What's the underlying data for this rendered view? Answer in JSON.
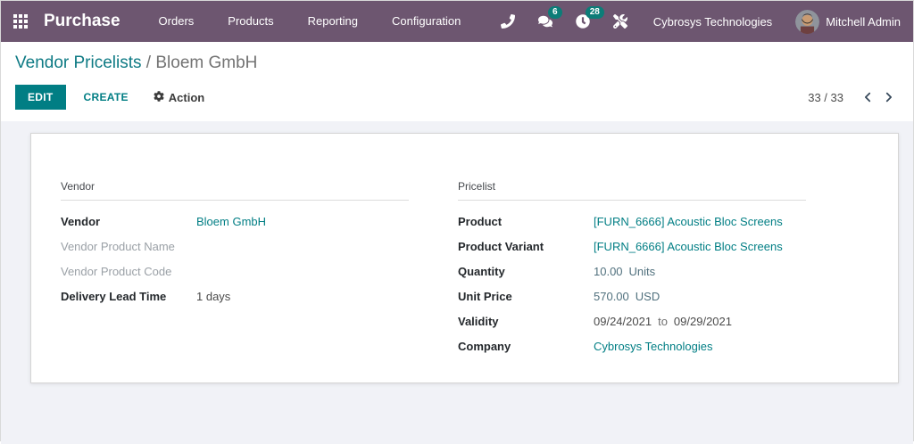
{
  "colors": {
    "navbar_bg": "#6d5670",
    "accent_teal": "#017e84",
    "badge_teal": "#0c7d78",
    "page_bg": "#f1f2f7",
    "link_teal": "#017e84"
  },
  "navbar": {
    "brand": "Purchase",
    "menus": {
      "orders": "Orders",
      "products": "Products",
      "reporting": "Reporting",
      "configuration": "Configuration"
    },
    "badges": {
      "messages": "6",
      "activities": "28"
    },
    "company": "Cybrosys Technologies",
    "user": "Mitchell Admin"
  },
  "breadcrumb": {
    "parent": "Vendor Pricelists",
    "separator": " / ",
    "current": "Bloem GmbH"
  },
  "control_panel": {
    "edit": "EDIT",
    "create": "CREATE",
    "action": "Action",
    "pager_count": "33 / 33"
  },
  "form": {
    "vendor": {
      "title": "Vendor",
      "vendor_label": "Vendor",
      "vendor_value": "Bloem GmbH",
      "product_name_label": "Vendor Product Name",
      "product_code_label": "Vendor Product Code",
      "lead_time_label": "Delivery Lead Time",
      "lead_time_value": "1 days"
    },
    "pricelist": {
      "title": "Pricelist",
      "product_label": "Product",
      "product_value": "[FURN_6666] Acoustic Bloc Screens",
      "variant_label": "Product Variant",
      "variant_value": "[FURN_6666] Acoustic Bloc Screens",
      "quantity_label": "Quantity",
      "quantity_value": "10.00",
      "quantity_unit": "Units",
      "unit_price_label": "Unit Price",
      "unit_price_value": "570.00",
      "unit_price_currency": "USD",
      "validity_label": "Validity",
      "validity_from": "09/24/2021",
      "validity_to_word": "to",
      "validity_to": "09/29/2021",
      "company_label": "Company",
      "company_value": "Cybrosys Technologies"
    }
  }
}
